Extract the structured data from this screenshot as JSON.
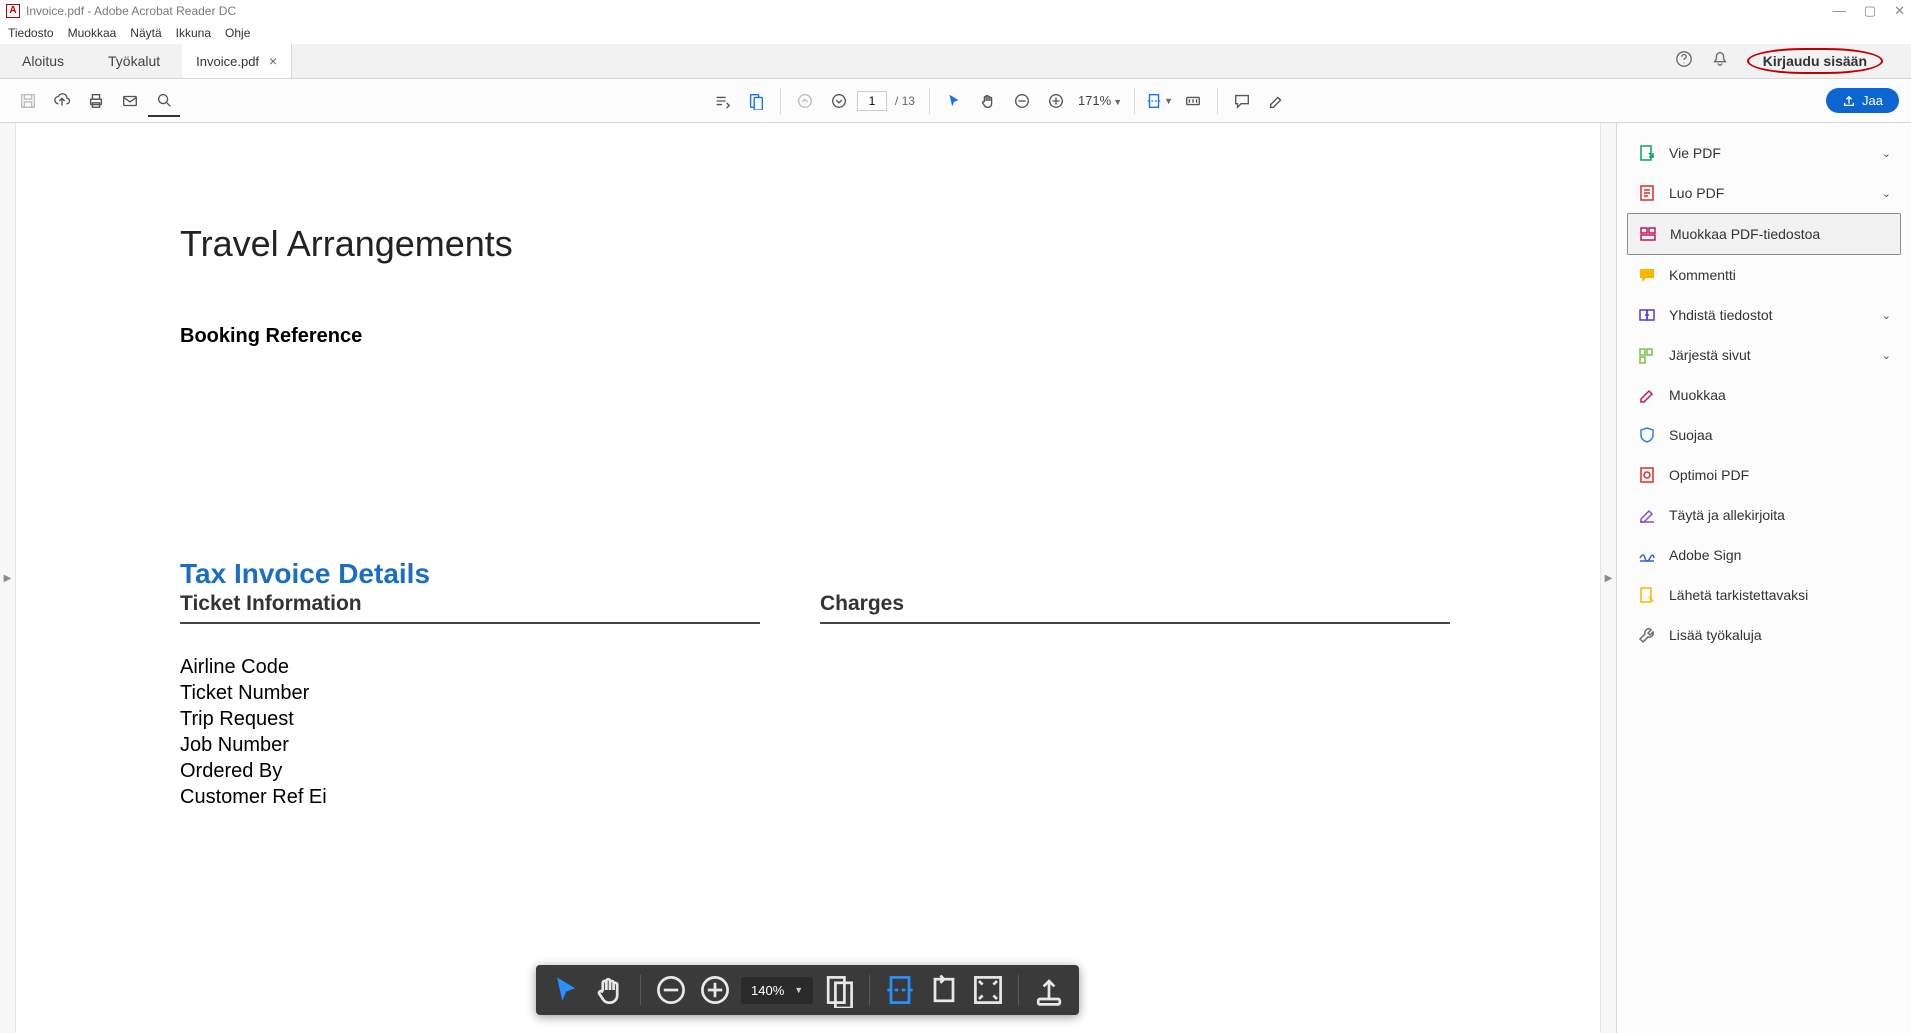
{
  "window": {
    "title": "Invoice.pdf - Adobe Acrobat Reader DC"
  },
  "menu": {
    "items": [
      "Tiedosto",
      "Muokkaa",
      "Näytä",
      "Ikkuna",
      "Ohje"
    ]
  },
  "tabs": {
    "home": "Aloitus",
    "tools": "Työkalut",
    "document": "Invoice.pdf",
    "signin": "Kirjaudu sisään"
  },
  "toolbar": {
    "page_current": "1",
    "page_total": "/ 13",
    "zoom": "171%",
    "share": "Jaa"
  },
  "document": {
    "title": "Travel Arrangements",
    "booking_ref_label": "Booking Reference",
    "section_title": "Tax Invoice Details",
    "col1_heading": "Ticket Information",
    "col2_heading": "Charges",
    "fields": [
      "Airline Code",
      "Ticket Number",
      "Trip Request",
      "Job Number",
      "Ordered By",
      "Customer Ref Ei"
    ]
  },
  "rightpanel": {
    "items": [
      {
        "label": "Vie PDF",
        "chevron": true,
        "color": "#0aa35a"
      },
      {
        "label": "Luo PDF",
        "chevron": true,
        "color": "#d93025"
      },
      {
        "label": "Muokkaa PDF-tiedostoa",
        "chevron": false,
        "color": "#c2185b",
        "selected": true
      },
      {
        "label": "Kommentti",
        "chevron": false,
        "color": "#f8b700"
      },
      {
        "label": "Yhdistä tiedostot",
        "chevron": true,
        "color": "#4e3ecf"
      },
      {
        "label": "Järjestä sivut",
        "chevron": true,
        "color": "#7cc04b"
      },
      {
        "label": "Muokkaa",
        "chevron": false,
        "color": "#c2185b"
      },
      {
        "label": "Suojaa",
        "chevron": false,
        "color": "#3a7de0"
      },
      {
        "label": "Optimoi PDF",
        "chevron": false,
        "color": "#d93025"
      },
      {
        "label": "Täytä ja allekirjoita",
        "chevron": false,
        "color": "#7e4fcf"
      },
      {
        "label": "Adobe Sign",
        "chevron": false,
        "color": "#3a5fcf"
      },
      {
        "label": "Lähetä tarkistettavaksi",
        "chevron": false,
        "color": "#f5b800"
      },
      {
        "label": "Lisää työkaluja",
        "chevron": false,
        "color": "#6a6a6a"
      }
    ]
  },
  "floatbar": {
    "zoom": "140%"
  }
}
